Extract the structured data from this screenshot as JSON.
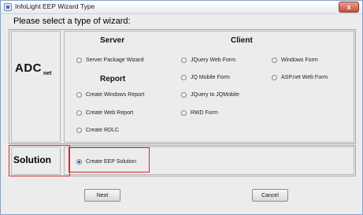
{
  "window": {
    "title": "InfoLight EEP Wizard Type",
    "close_label": "x"
  },
  "prompt": "Please select a type of wizard:",
  "adc_group": {
    "logo_text": "ADC",
    "logo_subscript": "net",
    "headings": {
      "server": "Server",
      "client": "Client",
      "report": "Report"
    },
    "options": {
      "server_package_wizard": "Server Package Wizard",
      "jquery_web_form": "JQuery Web Form",
      "windows_form": "Windows Form",
      "jq_mobile_form": "JQ Mobile Form",
      "asp_net_web_form": "ASP.net Web Form",
      "create_windows_report": "Create Windows Report",
      "jquery_to_jqmobile": "JQuery to JQMobile",
      "create_web_report": "Create Web Report",
      "rwd_form": "RWD Form",
      "create_rdlc": "Create RDLC"
    }
  },
  "solution_group": {
    "label": "Solution",
    "option": "Create EEP Solution",
    "selected": true
  },
  "buttons": {
    "next": "Next",
    "cancel": "Cancel"
  },
  "colors": {
    "highlight": "#e0242a",
    "radio_dot": "#1f4fa3",
    "window_bg": "#ececec"
  }
}
